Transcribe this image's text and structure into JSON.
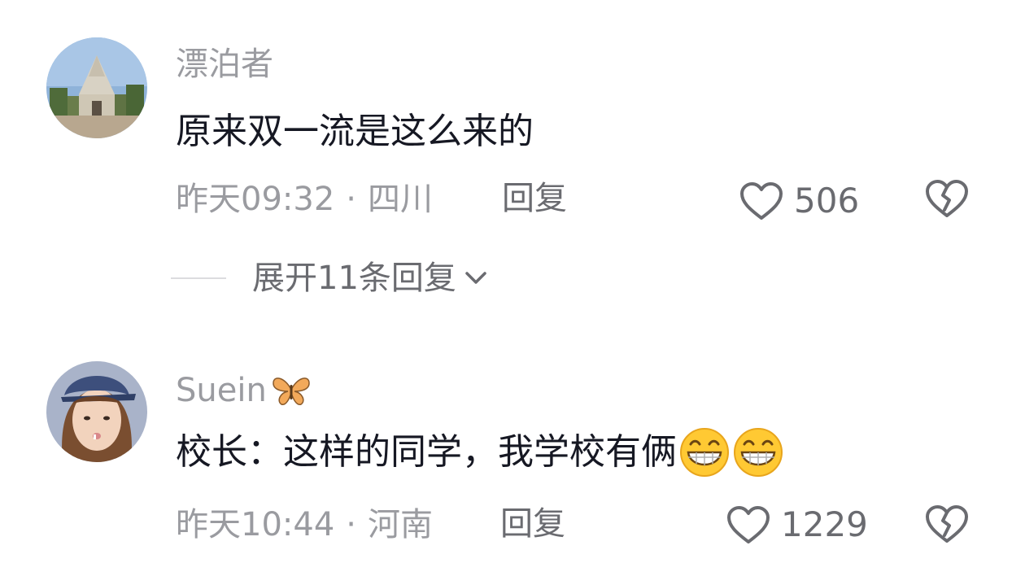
{
  "comments": [
    {
      "username": "漂泊者",
      "text": "原来双一流是这么来的",
      "time": "昨天09:32",
      "separator": "·",
      "location": "四川",
      "reply_label": "回复",
      "likes": "506",
      "avatar_icon": "temple-photo",
      "expand": {
        "label": "展开11条回复",
        "icon": "chevron-down-icon"
      }
    },
    {
      "username": "Suein",
      "username_emoji": "butterfly-icon",
      "text": "校长：这样的同学，我学校有俩",
      "text_emojis": [
        "grinning-face-icon",
        "grinning-face-icon"
      ],
      "time": "昨天10:44",
      "separator": "·",
      "location": "河南",
      "reply_label": "回复",
      "likes": "1229",
      "avatar_icon": "woman-cap-photo"
    }
  ],
  "colors": {
    "primary_text": "#161823",
    "secondary_text": "#9a9ba0",
    "action_text": "#6a6b70",
    "background": "#ffffff"
  }
}
